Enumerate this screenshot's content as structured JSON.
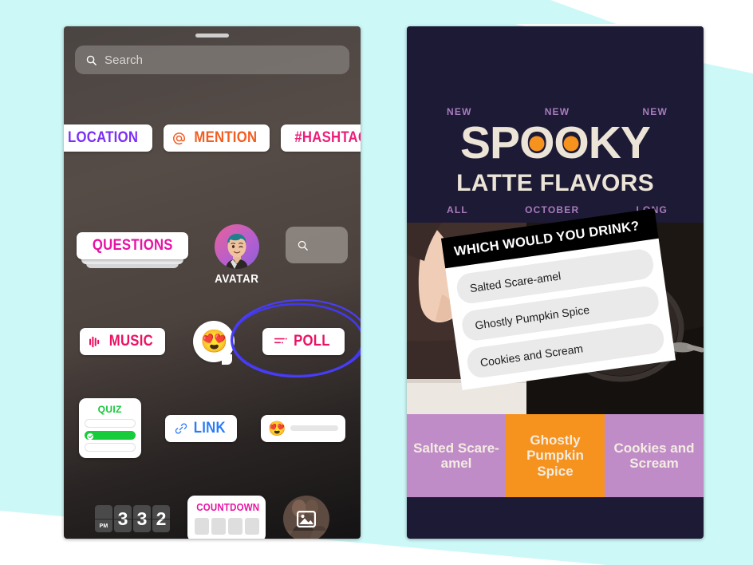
{
  "background": {
    "teal": "#cdf8f8",
    "white": "#ffffff"
  },
  "left_phone": {
    "name": "instagram-sticker-tray",
    "search": {
      "placeholder": "Search",
      "icon": "search-icon"
    },
    "stickers": {
      "location": {
        "label": "LOCATION",
        "icon": "location-pin-icon",
        "color": "#7b2ff7"
      },
      "mention": {
        "label": "MENTION",
        "icon": "at-symbol-icon",
        "color": "#f45d22"
      },
      "hashtag": {
        "label": "#HASHTAG",
        "color": "#ed1e79"
      },
      "questions": {
        "label": "QUESTIONS",
        "color": "#e812a4"
      },
      "avatar": {
        "label": "AVATAR",
        "icon": "avatar-icon"
      },
      "search_chip": {
        "icon": "search-icon"
      },
      "music": {
        "label": "MUSIC",
        "icon": "music-waveform-icon",
        "color": "#ec1162"
      },
      "emoji_bubble": {
        "emoji": "😍",
        "icon": "emoji-reaction-icon"
      },
      "poll": {
        "label": "POLL",
        "icon": "poll-bars-icon",
        "color": "#ec1162",
        "highlighted": true
      },
      "quiz": {
        "label": "QUIZ",
        "color": "#15c939",
        "options": 3,
        "correct_index": 1
      },
      "link": {
        "label": "LINK",
        "icon": "link-chain-icon",
        "color": "#2b7cf6"
      },
      "emoji_slider": {
        "emoji": "😍",
        "icon": "emoji-slider-icon"
      },
      "countdown_clock": {
        "ampm": "PM",
        "digits": [
          "3",
          "3",
          "2"
        ]
      },
      "countdown": {
        "label": "COUNTDOWN",
        "color": "#e812a4",
        "boxes": 4
      },
      "photo": {
        "icon": "photo-sticker-icon"
      }
    },
    "annotation": {
      "name": "blue-circle-highlight",
      "color": "#4338f0",
      "targets": "poll"
    }
  },
  "right_phone": {
    "name": "instagram-story-poll-example",
    "background_color": "#1d1a35",
    "headline": {
      "new_labels": [
        "NEW",
        "NEW",
        "NEW"
      ],
      "title_pre": "SP",
      "title_o1": "O",
      "title_o2": "O",
      "title_post": "KY",
      "title_full": "SPOOKY",
      "subtitle": "LATTE FLAVORS",
      "sub_labels": [
        "ALL",
        "OCTOBER",
        "LONG"
      ],
      "accent_color": "#f6921e",
      "label_color": "#a87bbd",
      "text_color": "#ece4d6"
    },
    "poll": {
      "question": "WHICH WOULD YOU DRINK?",
      "options": [
        "Salted Scare-amel",
        "Ghostly Pumpkin Spice",
        "Cookies and Scream"
      ]
    },
    "result_bars": [
      {
        "label": "Salted Scare-amel",
        "color": "#c08cc8"
      },
      {
        "label": "Ghostly Pumpkin Spice",
        "color": "#f6921e"
      },
      {
        "label": "Cookies and Scream",
        "color": "#c08cc8"
      }
    ]
  }
}
